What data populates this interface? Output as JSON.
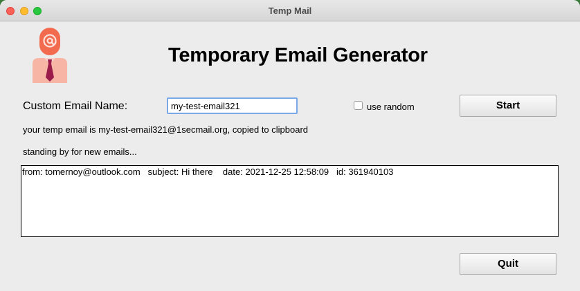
{
  "window": {
    "title": "Temp Mail"
  },
  "header": {
    "heading": "Temporary Email Generator",
    "logo_icon": "person-with-at-sign-icon"
  },
  "form": {
    "name_label": "Custom Email Name:",
    "name_value": "my-test-email321",
    "random_label": "use random",
    "random_checked": false,
    "start_label": "Start"
  },
  "status": {
    "email_message": "your temp email is my-test-email321@1secmail.org, copied to clipboard",
    "standby_message": "standing by for new emails..."
  },
  "mail_list": {
    "entries": [
      "from: tomernoy@outlook.com   subject: Hi there    date: 2021-12-25 12:58:09   id: 361940103"
    ]
  },
  "footer": {
    "quit_label": "Quit"
  },
  "colors": {
    "logo_head": "#f26b4f",
    "logo_body": "#f7b5a6",
    "logo_tie": "#9b1b4b",
    "focus_ring": "#7aa7e8"
  }
}
